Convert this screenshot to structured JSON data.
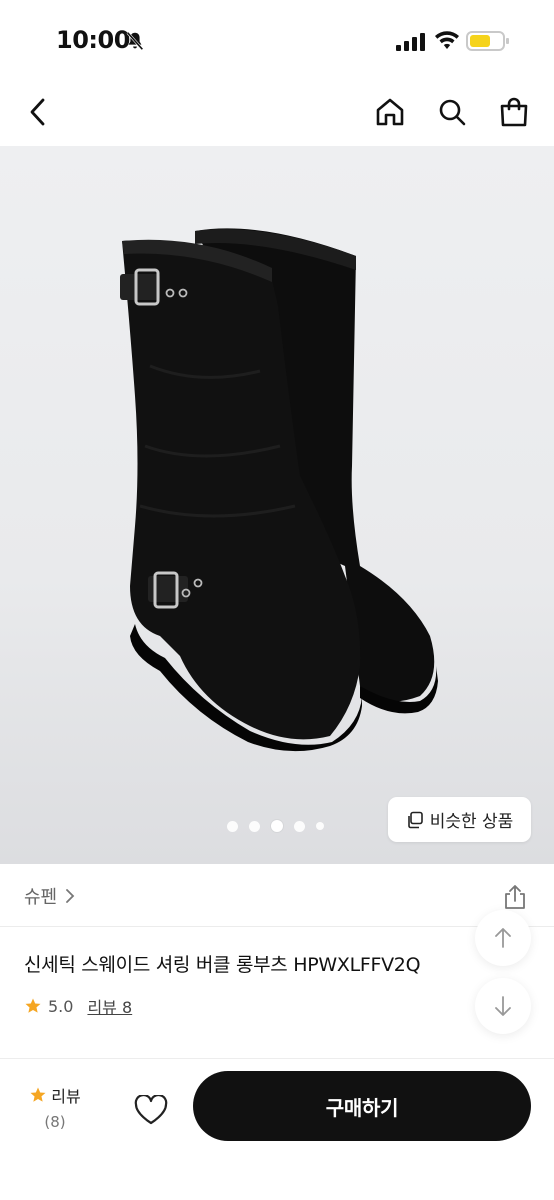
{
  "status": {
    "time": "10:00"
  },
  "hero": {
    "similar_label": "비슷한 상품",
    "dots_count": 5,
    "active_dot": 2
  },
  "product": {
    "brand": "슈펜",
    "title": "신세틱 스웨이드 셔링 버클 롱부츠 HPWXLFFV2Q",
    "rating": "5.0",
    "review_link": "리뷰 8"
  },
  "bottom": {
    "review_label": "리뷰",
    "review_count": "(8)",
    "buy_label": "구매하기"
  },
  "colors": {
    "accent_star": "#f5a623",
    "buy_button": "#111111"
  }
}
